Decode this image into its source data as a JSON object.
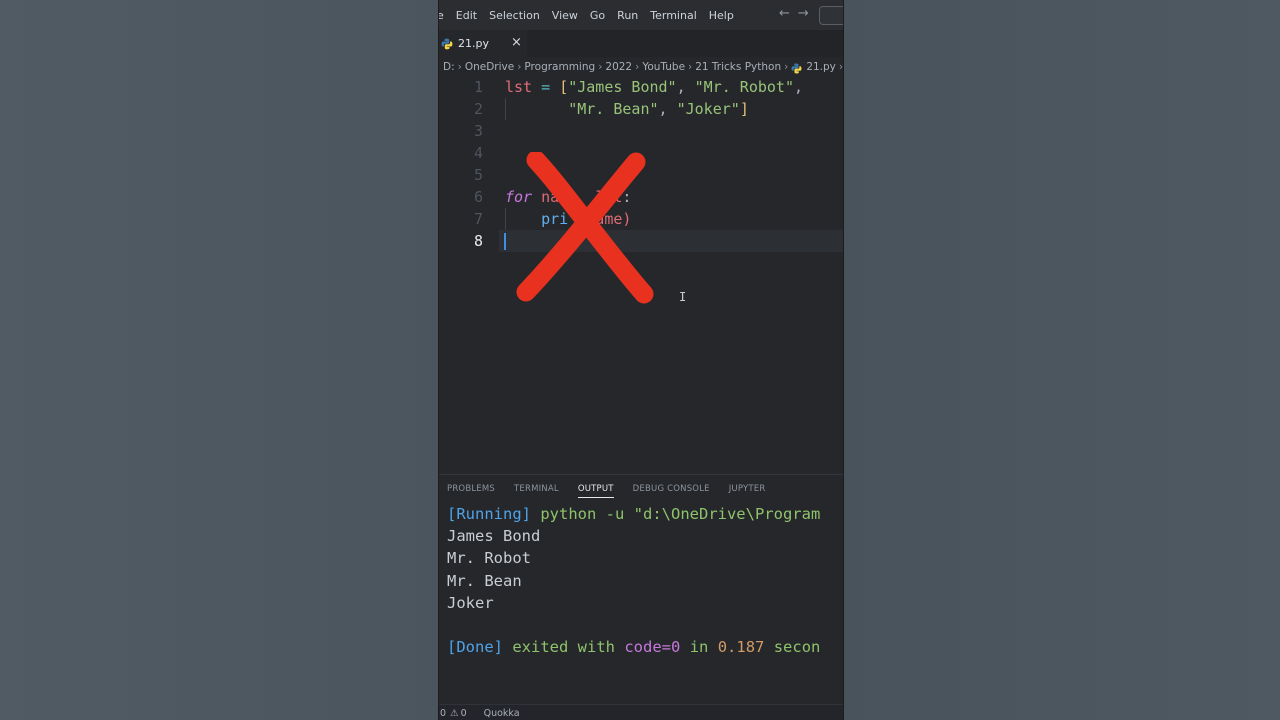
{
  "menubar": {
    "items": [
      "Edit",
      "Selection",
      "View",
      "Go",
      "Run",
      "Terminal",
      "Help"
    ],
    "leading_fragment": "e"
  },
  "tab": {
    "label": "21.py",
    "close_glyph": "×"
  },
  "breadcrumb": [
    "D:",
    "OneDrive",
    "Programming",
    "2022",
    "YouTube",
    "21 Tricks Python",
    "21.py",
    "..."
  ],
  "editor": {
    "line_numbers": [
      "1",
      "2",
      "3",
      "4",
      "5",
      "6",
      "7",
      "8"
    ],
    "current_line": "8",
    "code": {
      "l1": {
        "var": "lst",
        "op": "=",
        "open": "[",
        "s1": "\"James Bond\"",
        "c1": ",",
        "s2": "\"Mr. Robot\"",
        "c2": ","
      },
      "l2": {
        "s3": "\"Mr. Bean\"",
        "c3": ",",
        "s4": "\"Joker\"",
        "close": "]"
      },
      "l6": {
        "kw": "for",
        "mid": "na",
        "lst": "lst",
        "colon": ":"
      },
      "l7": {
        "fn": "pri",
        "arg": "name)"
      }
    }
  },
  "panel": {
    "tabs": [
      "PROBLEMS",
      "TERMINAL",
      "OUTPUT",
      "DEBUG CONSOLE",
      "JUPYTER"
    ],
    "active_tab": "OUTPUT",
    "output": {
      "running_tag": "[Running]",
      "command": "python -u \"d:\\OneDrive\\Program",
      "lines": [
        "James Bond",
        "Mr. Robot",
        "Mr. Bean",
        "Joker"
      ],
      "done_tag": "[Done]",
      "done_a": "exited with",
      "done_code": "code=0",
      "done_in": "in",
      "done_time": "0.187",
      "done_end": "secon"
    }
  },
  "statusbar": {
    "errors": "0",
    "warnings": "0",
    "quokka": "Quokka"
  },
  "colors": {
    "overlay_x": "#e8321f",
    "accent_caret": "#3f8fe0"
  }
}
